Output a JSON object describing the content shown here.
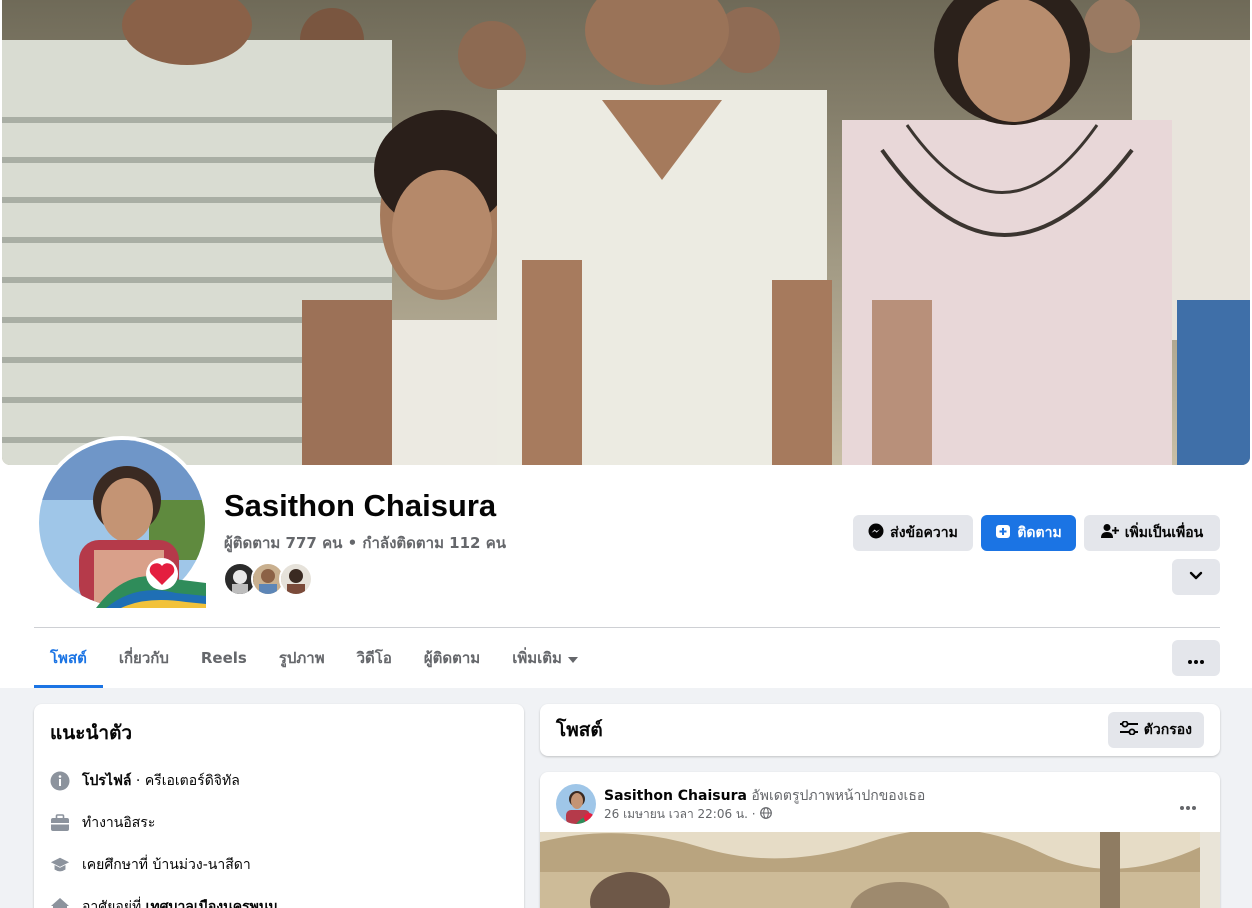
{
  "profile": {
    "name": "Sasithon Chaisura",
    "stats": "ผู้ติดตาม 777 คน • กำลังติดตาม 112 คน"
  },
  "actions": {
    "message_label": "ส่งข้อความ",
    "follow_label": "ติดตาม",
    "add_friend_label": "เพิ่มเป็นเพื่อน"
  },
  "tabs": [
    {
      "label": "โพสต์",
      "active": true
    },
    {
      "label": "เกี่ยวกับ",
      "active": false
    },
    {
      "label": "Reels",
      "active": false
    },
    {
      "label": "รูปภาพ",
      "active": false
    },
    {
      "label": "วิดีโอ",
      "active": false
    },
    {
      "label": "ผู้ติดตาม",
      "active": false
    },
    {
      "label": "เพิ่มเติม",
      "active": false
    }
  ],
  "intro": {
    "title": "แนะนำตัว",
    "items": [
      {
        "icon": "info-icon",
        "bold": "โปรไฟล์",
        "text": " · ครีเอเตอร์ดิจิทัล"
      },
      {
        "icon": "briefcase-icon",
        "bold": "",
        "text": "ทำงานอิสระ"
      },
      {
        "icon": "graduation-cap-icon",
        "bold": "",
        "text": "เคยศึกษาที่ บ้านม่วง-นาสีดา"
      },
      {
        "icon": "home-icon",
        "prefix": "อาศัยอยู่ที่ ",
        "bold": "เทศบาลเมืองนครพนม",
        "text": ""
      }
    ]
  },
  "posts": {
    "title": "โพสต์",
    "filter_label": "ตัวกรอง",
    "first": {
      "author": "Sasithon Chaisura",
      "action": " อัพเดตรูปภาพหน้าปกของเธอ",
      "timestamp": "26 เมษายน เวลา 22:06 น. ·"
    }
  },
  "colors": {
    "accent": "#1b74e4",
    "button_grey": "#e4e6eb",
    "secondary_text": "#65676b",
    "background": "#f0f2f5"
  }
}
